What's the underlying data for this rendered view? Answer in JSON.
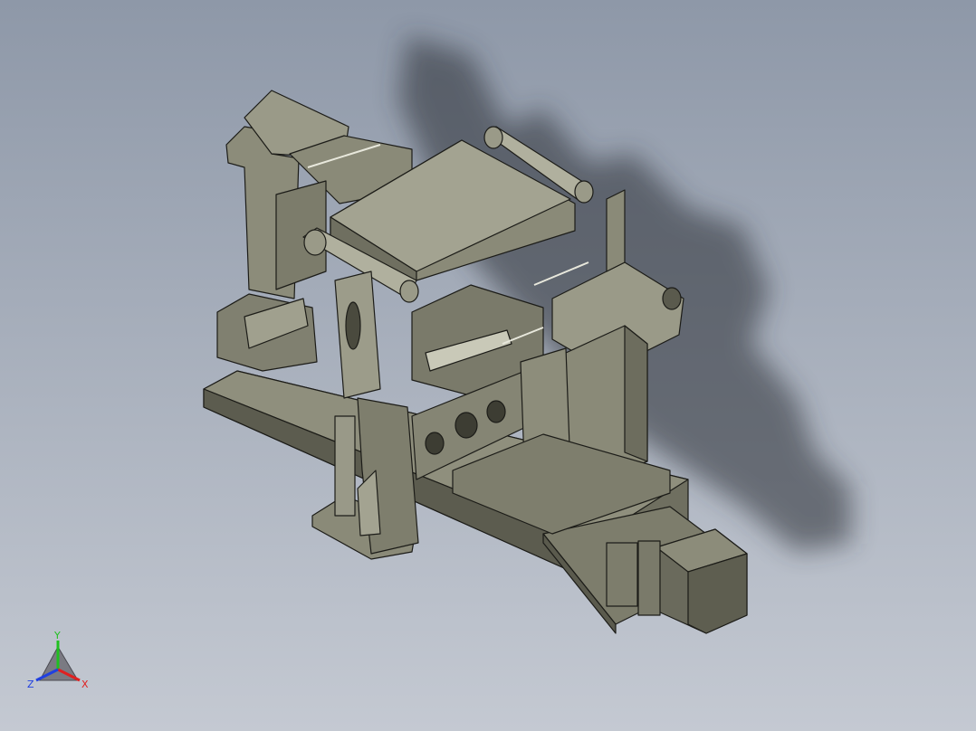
{
  "viewport": {
    "background_top": "#8e98a8",
    "background_bottom": "#c4c9d2"
  },
  "model": {
    "body_color": "#8a8a78",
    "shadow_color": "#2a2e35",
    "edge_color": "#1c1c18"
  },
  "triad": {
    "x_label": "X",
    "y_label": "Y",
    "z_label": "Z",
    "x_color": "#e02020",
    "y_color": "#20c020",
    "z_color": "#2040e0"
  }
}
